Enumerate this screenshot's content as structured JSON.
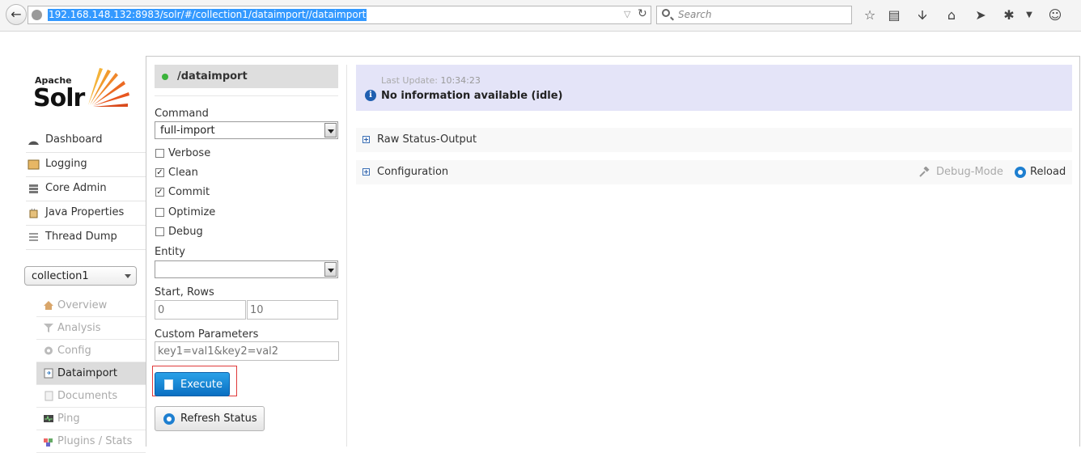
{
  "browser": {
    "url": "192.168.148.132:8983/solr/#/collection1/dataimport//dataimport",
    "search_placeholder": "Search"
  },
  "logo": {
    "apache": "Apache",
    "solr": "Solr"
  },
  "nav": {
    "items": [
      {
        "label": "Dashboard",
        "icon": "dashboard-icon"
      },
      {
        "label": "Logging",
        "icon": "logging-icon"
      },
      {
        "label": "Core Admin",
        "icon": "core-admin-icon"
      },
      {
        "label": "Java Properties",
        "icon": "java-properties-icon"
      },
      {
        "label": "Thread Dump",
        "icon": "thread-dump-icon"
      }
    ],
    "core_selector": "collection1",
    "core_items": [
      {
        "label": "Overview",
        "icon": "overview-icon"
      },
      {
        "label": "Analysis",
        "icon": "analysis-icon"
      },
      {
        "label": "Config",
        "icon": "config-icon"
      },
      {
        "label": "Dataimport",
        "icon": "dataimport-icon",
        "active": true
      },
      {
        "label": "Documents",
        "icon": "documents-icon"
      },
      {
        "label": "Ping",
        "icon": "ping-icon"
      },
      {
        "label": "Plugins / Stats",
        "icon": "plugins-icon"
      }
    ]
  },
  "handler": {
    "title": "/dataimport",
    "status_color": "#3bb33b"
  },
  "form": {
    "command_label": "Command",
    "command_value": "full-import",
    "options": [
      {
        "label": "Verbose",
        "checked": false
      },
      {
        "label": "Clean",
        "checked": true
      },
      {
        "label": "Commit",
        "checked": true
      },
      {
        "label": "Optimize",
        "checked": false
      },
      {
        "label": "Debug",
        "checked": false
      }
    ],
    "entity_label": "Entity",
    "entity_value": "",
    "start_rows_label": "Start, Rows",
    "start_placeholder": "0",
    "rows_placeholder": "10",
    "custom_params_label": "Custom Parameters",
    "custom_params_placeholder": "key1=val1&key2=val2",
    "execute_label": "Execute",
    "refresh_label": "Refresh Status"
  },
  "status": {
    "last_update_label": "Last Update:",
    "last_update_time": "10:34:23",
    "message": "No information available (idle)"
  },
  "sections": {
    "raw_status": "Raw Status-Output",
    "configuration": "Configuration",
    "debug_mode": "Debug-Mode",
    "reload": "Reload"
  },
  "colors": {
    "accent": "#1e7fd0",
    "status_bg": "#e4e4f8"
  }
}
